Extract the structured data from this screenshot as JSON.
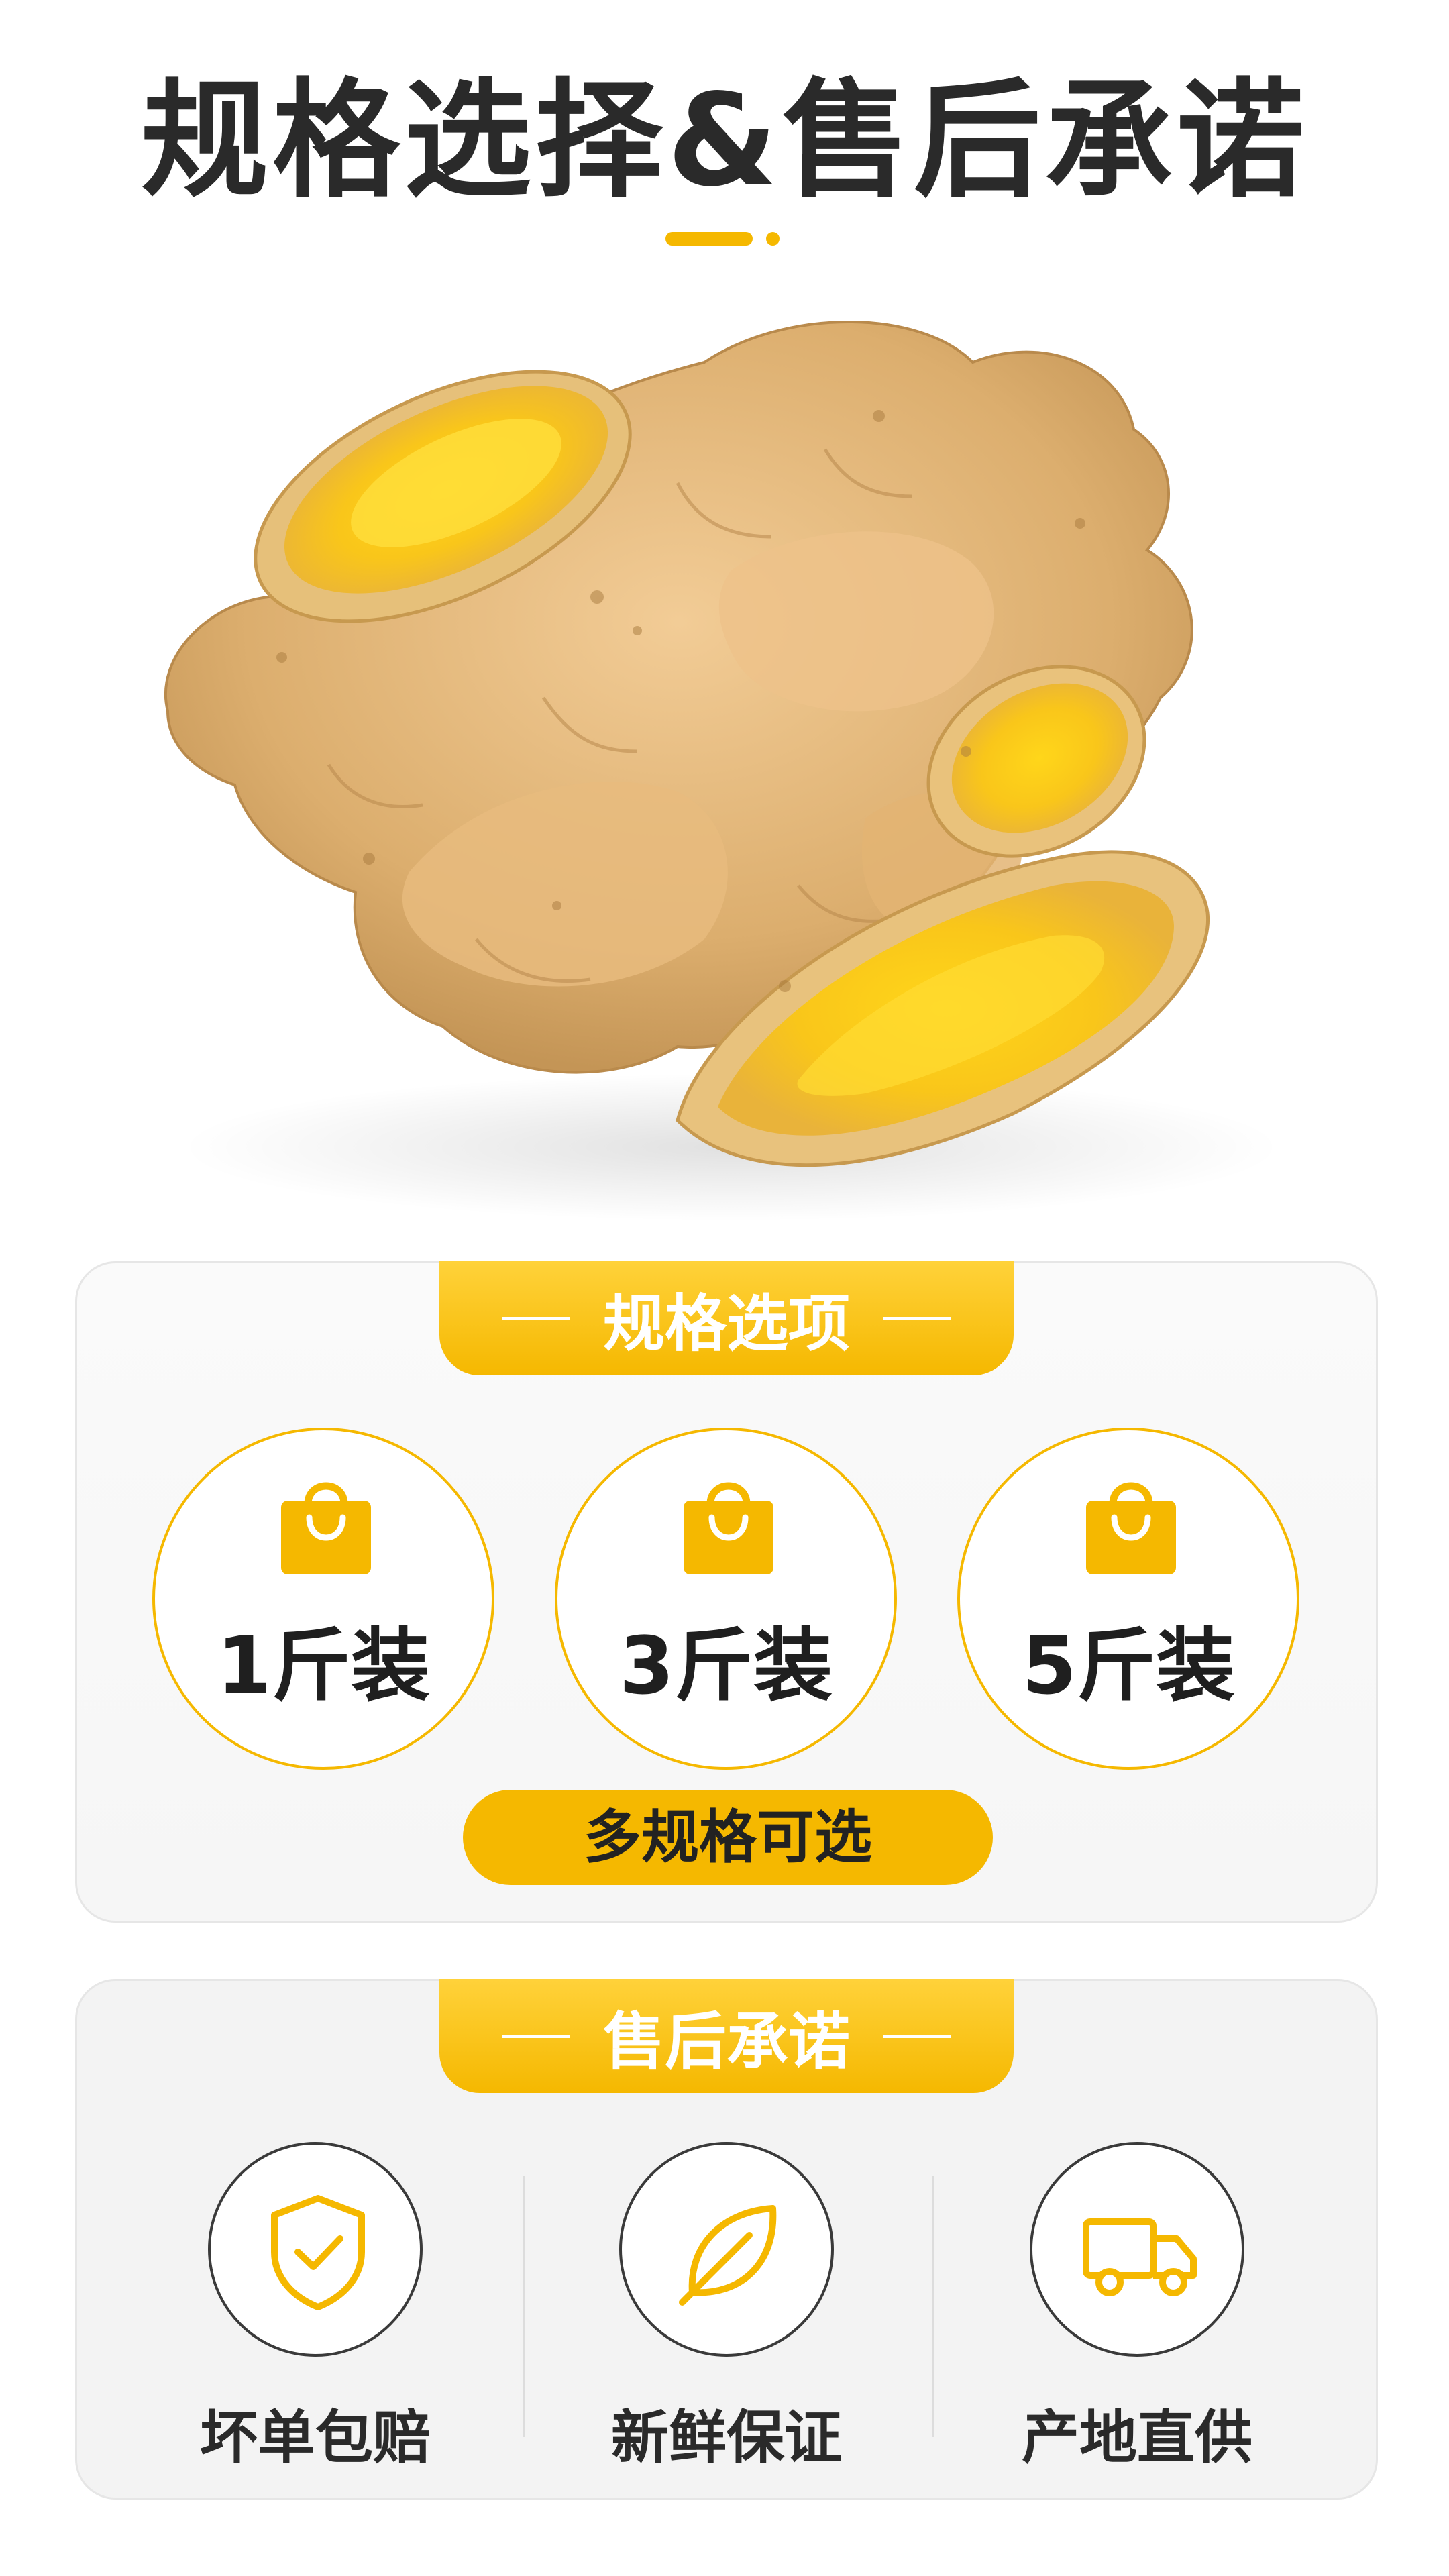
{
  "page": {
    "title": "规格选择&售后承诺"
  },
  "colors": {
    "accent": "#f5b800",
    "text": "#2a2a2a",
    "card_bg": "#f9f9f9"
  },
  "hero": {
    "image": "ginger-photo"
  },
  "spec": {
    "tab_label": "规格选项",
    "options": [
      {
        "label": "1斤装",
        "icon": "shopping-bag-icon"
      },
      {
        "label": "3斤装",
        "icon": "shopping-bag-icon"
      },
      {
        "label": "5斤装",
        "icon": "shopping-bag-icon"
      }
    ],
    "note": "多规格可选"
  },
  "promise": {
    "tab_label": "售后承诺",
    "items": [
      {
        "label": "坏单包赔",
        "icon": "shield-check-icon"
      },
      {
        "label": "新鲜保证",
        "icon": "leaf-icon"
      },
      {
        "label": "产地直供",
        "icon": "truck-icon"
      }
    ]
  }
}
